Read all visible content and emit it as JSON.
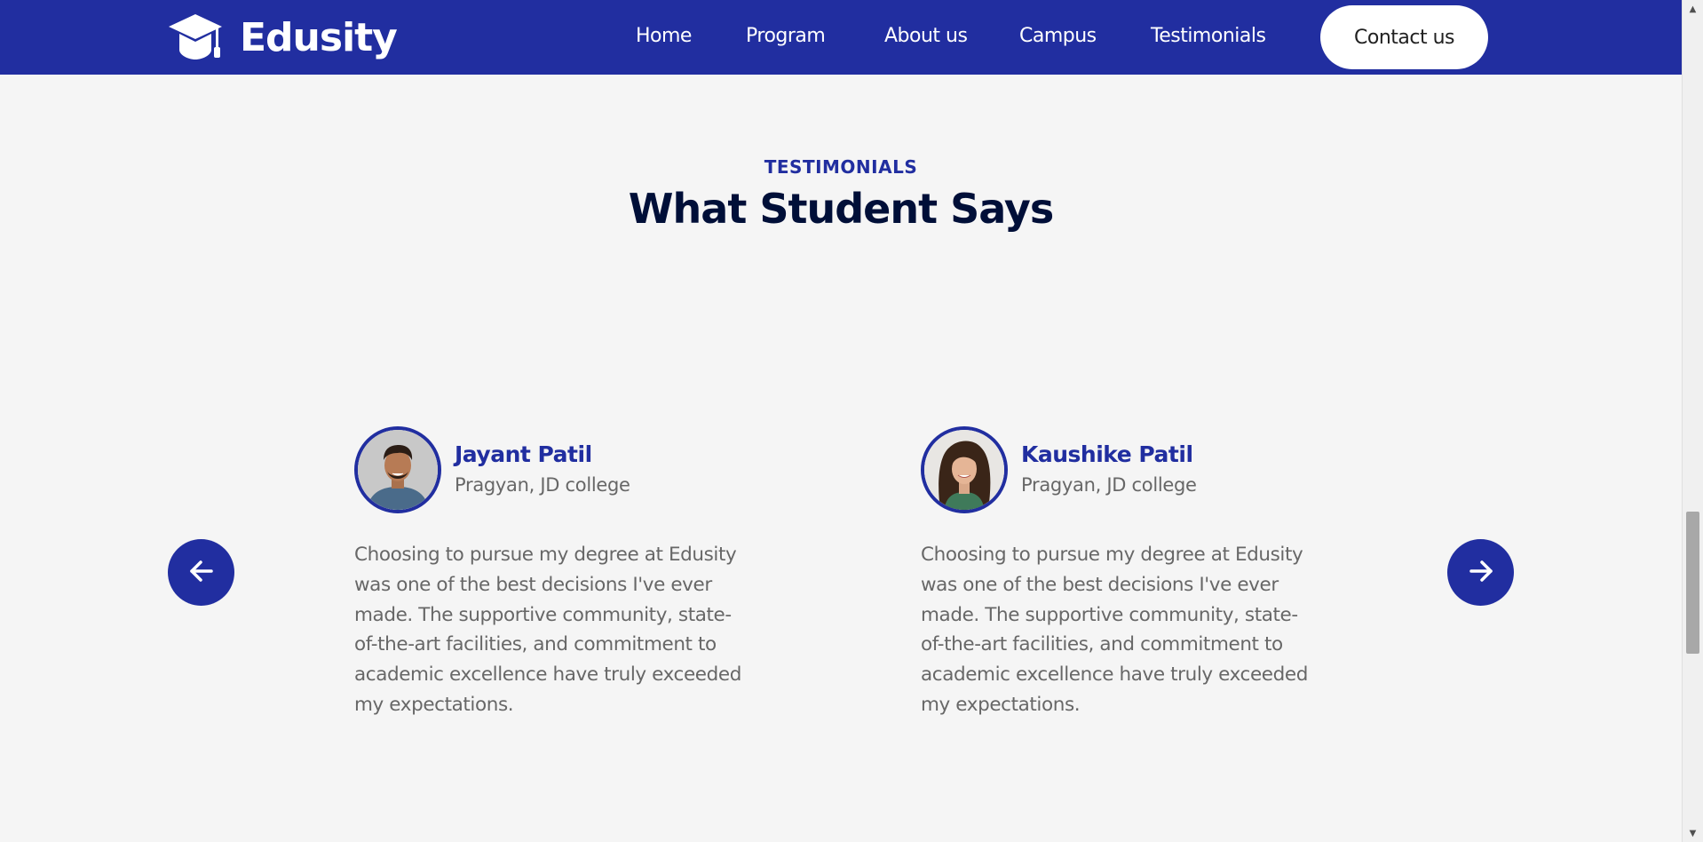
{
  "brand": {
    "name": "Edusity",
    "logo_icon": "graduation-cap-icon",
    "primary_color": "#212ea0",
    "heading_color": "#000f38",
    "text_color": "#676767"
  },
  "nav": {
    "links": [
      "Home",
      "Program",
      "About us",
      "Campus",
      "Testimonials"
    ],
    "contact_label": "Contact us"
  },
  "section": {
    "eyebrow": "TESTIMONIALS",
    "title": "What Student Says"
  },
  "carousel": {
    "prev_icon": "arrow-left-icon",
    "next_icon": "arrow-right-icon"
  },
  "testimonials": [
    {
      "name": "Jayant Patil",
      "school": "Pragyan, JD college",
      "quote": "Choosing to pursue my degree at Edusity was one of the best decisions I've ever made. The supportive community, state-of-the-art facilities, and commitment to academic excellence have truly exceeded my expectations."
    },
    {
      "name": "Kaushike Patil",
      "school": "Pragyan, JD college",
      "quote": "Choosing to pursue my degree at Edusity was one of the best decisions I've ever made. The supportive community, state-of-the-art facilities, and commitment to academic excellence have truly exceeded my expectations."
    }
  ]
}
